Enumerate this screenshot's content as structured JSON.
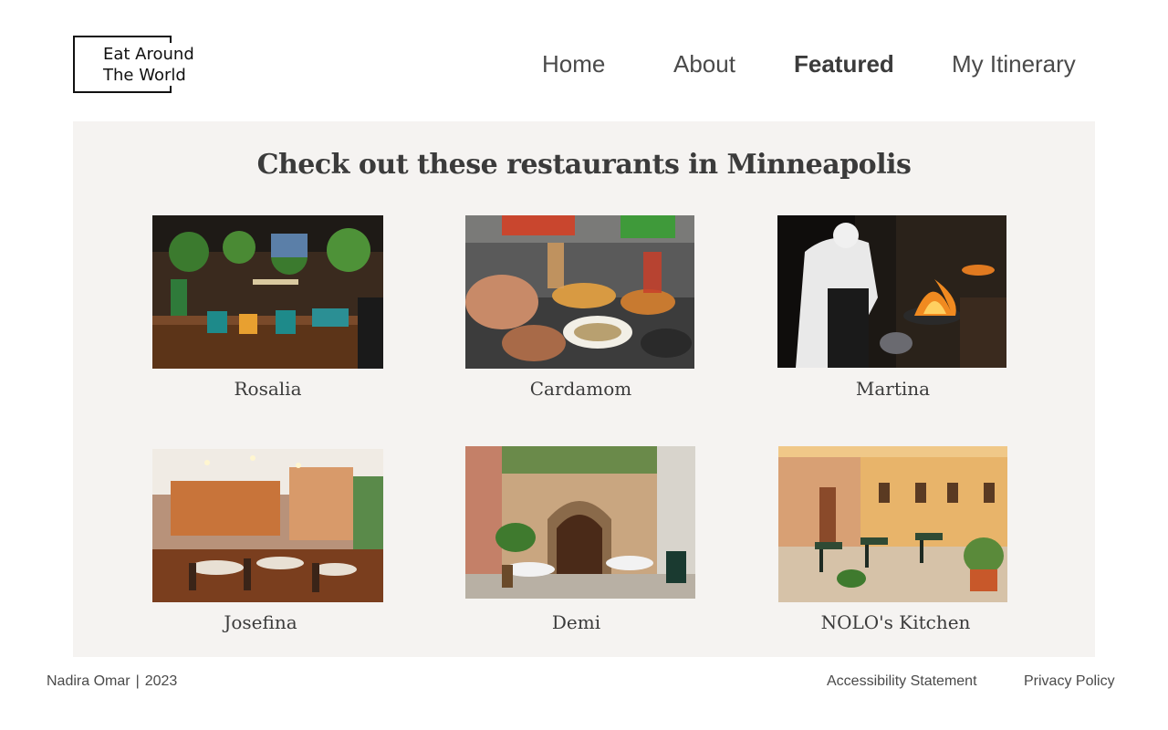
{
  "brand": {
    "line1": "Eat Around",
    "line2": "The World"
  },
  "nav": {
    "items": [
      {
        "label": "Home"
      },
      {
        "label": "About"
      },
      {
        "label": "Featured"
      },
      {
        "label": "My Itinerary"
      }
    ],
    "active": "Featured"
  },
  "main": {
    "title": "Check out these restaurants in Minneapolis",
    "restaurants": [
      {
        "name": "Rosalia",
        "image": "restaurant-interior-plants-teal-chairs"
      },
      {
        "name": "Cardamom",
        "image": "shared-dishes-on-table"
      },
      {
        "name": "Martina",
        "image": "chef-cooking-with-flame"
      },
      {
        "name": "Josefina",
        "image": "warm-dining-room"
      },
      {
        "name": "Demi",
        "image": "stone-courtyard-tables"
      },
      {
        "name": "NOLO's Kitchen",
        "image": "outdoor-street-patio"
      }
    ]
  },
  "footer": {
    "author": "Nadira Omar",
    "separator": "|",
    "year": "2023",
    "links": [
      {
        "label": "Accessibility Statement"
      },
      {
        "label": "Privacy Policy"
      }
    ]
  },
  "colors": {
    "panel_bg": "#f5f3f1",
    "text": "#3b3b3b"
  }
}
